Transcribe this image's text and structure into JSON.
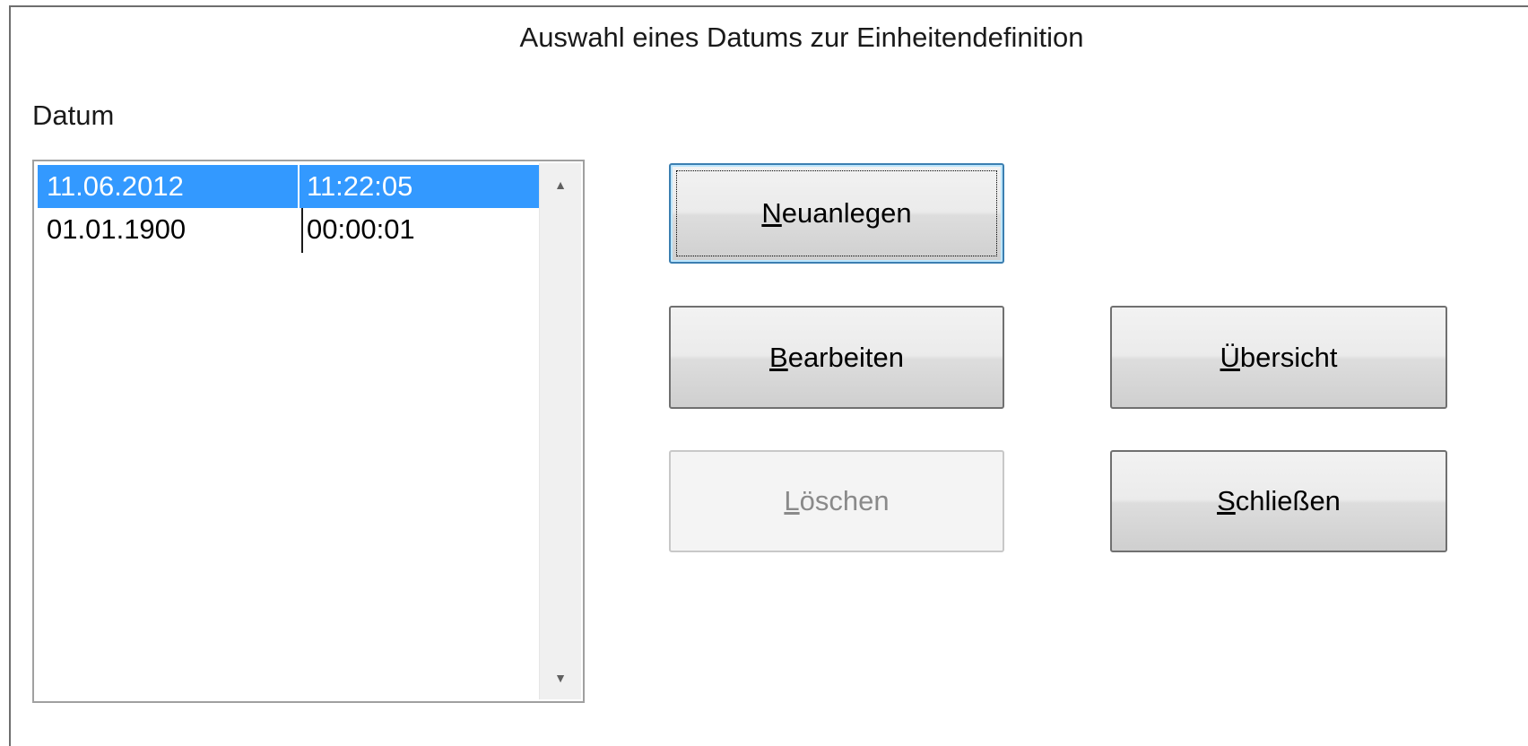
{
  "dialog": {
    "title": "Auswahl eines Datums zur Einheitendefinition"
  },
  "datum_label": "Datum",
  "list": {
    "rows": [
      {
        "date": "11.06.2012",
        "time": "11:22:05",
        "selected": true
      },
      {
        "date": "01.01.1900",
        "time": "00:00:01",
        "selected": false
      }
    ],
    "scroll_up_icon": "scroll-up-arrow",
    "scroll_down_icon": "scroll-down-arrow"
  },
  "buttons": {
    "neuanlegen": {
      "accel": "N",
      "rest": "euanlegen",
      "state": "focused"
    },
    "bearbeiten": {
      "accel": "B",
      "rest": "earbeiten",
      "state": "enabled"
    },
    "loeschen": {
      "accel": "L",
      "rest": "öschen",
      "state": "disabled"
    },
    "uebersicht": {
      "accel": "Ü",
      "rest": "bersicht",
      "state": "enabled"
    },
    "schliessen": {
      "accel": "S",
      "rest": "chließen",
      "state": "enabled"
    }
  },
  "colors": {
    "selection": "#3399ff",
    "focus_border": "#3c7fb1",
    "disabled_text": "#8a8a8a"
  }
}
